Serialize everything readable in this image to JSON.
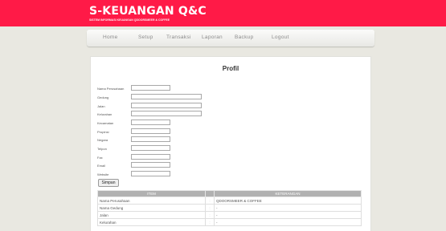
{
  "app": {
    "title": "S-KEUANGAN Q&C",
    "subtitle": "SISTEM INFORMASI KEUANGAN QDOORSMEER & COFFEE"
  },
  "nav": {
    "items": [
      {
        "label": "Home"
      },
      {
        "label": "Setup"
      },
      {
        "label": "Transaksi"
      },
      {
        "label": "Laporan"
      },
      {
        "label": "Backup"
      },
      {
        "label": "Logout"
      }
    ]
  },
  "page": {
    "title": "Profil"
  },
  "form": {
    "fields": [
      {
        "label": "Nama Perusahaan",
        "value": ""
      },
      {
        "label": "Gedung",
        "value": ""
      },
      {
        "label": "Jalan",
        "value": ""
      },
      {
        "label": "Kelurahan",
        "value": ""
      },
      {
        "label": "Kecamatan",
        "value": ""
      },
      {
        "label": "Propinsi",
        "value": ""
      },
      {
        "label": "Negara",
        "value": ""
      },
      {
        "label": "Telpon",
        "value": ""
      },
      {
        "label": "Fax",
        "value": ""
      },
      {
        "label": "Email",
        "value": ""
      },
      {
        "label": "Website",
        "value": ""
      }
    ],
    "save_label": "Simpan"
  },
  "table": {
    "headers": [
      "ITEM",
      "",
      "KETERANGAN"
    ],
    "rows": [
      {
        "item": "Nama Perusahaan",
        "sep": ":",
        "value": "QDOORSMEER & COFFEE"
      },
      {
        "item": "Nama Gedung",
        "sep": ":",
        "value": "-"
      },
      {
        "item": "Jalan",
        "sep": ":",
        "value": "-"
      },
      {
        "item": "Kelurahan",
        "sep": ":",
        "value": "-"
      }
    ]
  },
  "colors": {
    "header_bg": "#ff1a47",
    "page_bg": "#e9e8e1",
    "table_header_bg": "#b1b1b1"
  }
}
